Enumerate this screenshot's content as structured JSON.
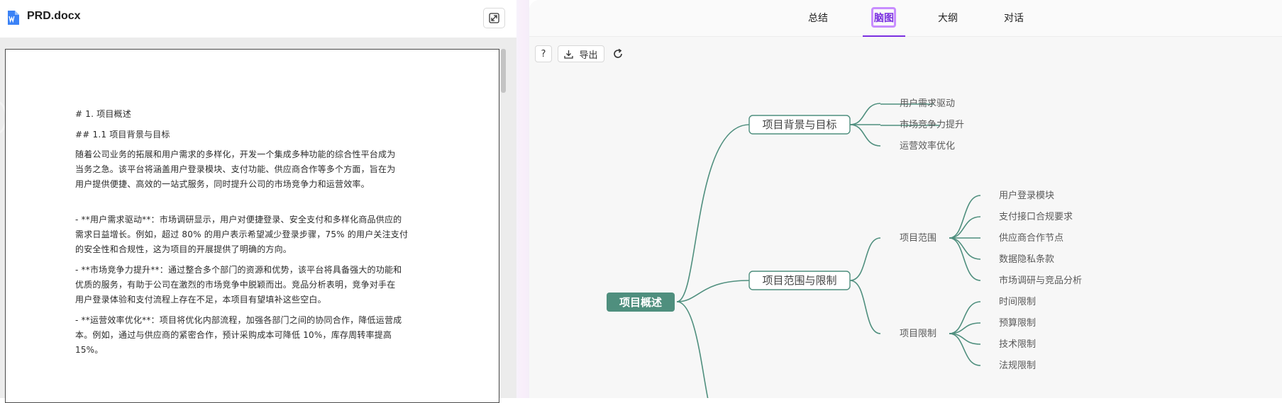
{
  "document": {
    "file_name": "PRD.docx",
    "lines": {
      "h1": "# 1. 项目概述",
      "h2": "## 1.1 项目背景与目标",
      "para1_l1": "随着公司业务的拓展和用户需求的多样化，开发一个集成多种功能的综合性平台成为",
      "para1_l2": "当务之急。该平台将涵盖用户登录模块、支付功能、供应商合作等多个方面，旨在为",
      "para1_l3": "用户提供便捷、高效的一站式服务，同时提升公司的市场竞争力和运营效率。",
      "b1_l1": "- **用户需求驱动**：市场调研显示，用户对便捷登录、安全支付和多样化商品供应的",
      "b1_l2": "需求日益增长。例如，超过 80% 的用户表示希望减少登录步骤，75% 的用户关注支付",
      "b1_l3": "的安全性和合规性，这为项目的开展提供了明确的方向。",
      "b2_l1": "- **市场竞争力提升**：通过整合多个部门的资源和优势，该平台将具备强大的功能和",
      "b2_l2": "优质的服务，有助于公司在激烈的市场竞争中脱颖而出。竞品分析表明，竞争对手在",
      "b2_l3": "用户登录体验和支付流程上存在不足，本项目有望填补这些空白。",
      "b3_l1": "- **运营效率优化**：项目将优化内部流程，加强各部门之间的协同合作，降低运营成",
      "b3_l2": "本。例如，通过与供应商的紧密合作，预计采购成本可降低 10%，库存周转率提高",
      "b3_l3": "15%。"
    }
  },
  "tabs": {
    "summary": "总结",
    "mindmap": "脑图",
    "outline": "大纲",
    "chat": "对话"
  },
  "toolbar": {
    "help": "?",
    "export": "导出"
  },
  "mindmap": {
    "root": "项目概述",
    "branch1": "项目背景与目标",
    "branch1_leaves": [
      "用户需求驱动",
      "市场竞争力提升",
      "运营效率优化"
    ],
    "branch2": "项目范围与限制",
    "scope": "项目范围",
    "scope_leaves": [
      "用户登录模块",
      "支付接口合规要求",
      "供应商合作节点",
      "数据隐私条款",
      "市场调研与竞品分析"
    ],
    "limits": "项目限制",
    "limit_leaves": [
      "时间限制",
      "预算限制",
      "技术限制",
      "法规限制"
    ]
  },
  "colors": {
    "accent_purple": "#7a2fe0",
    "mindmap_green": "#4f8f7e",
    "doc_icon_blue": "#3b82f6"
  },
  "icons": [
    "word-doc-icon",
    "expand-icon",
    "download-icon",
    "refresh-icon"
  ]
}
